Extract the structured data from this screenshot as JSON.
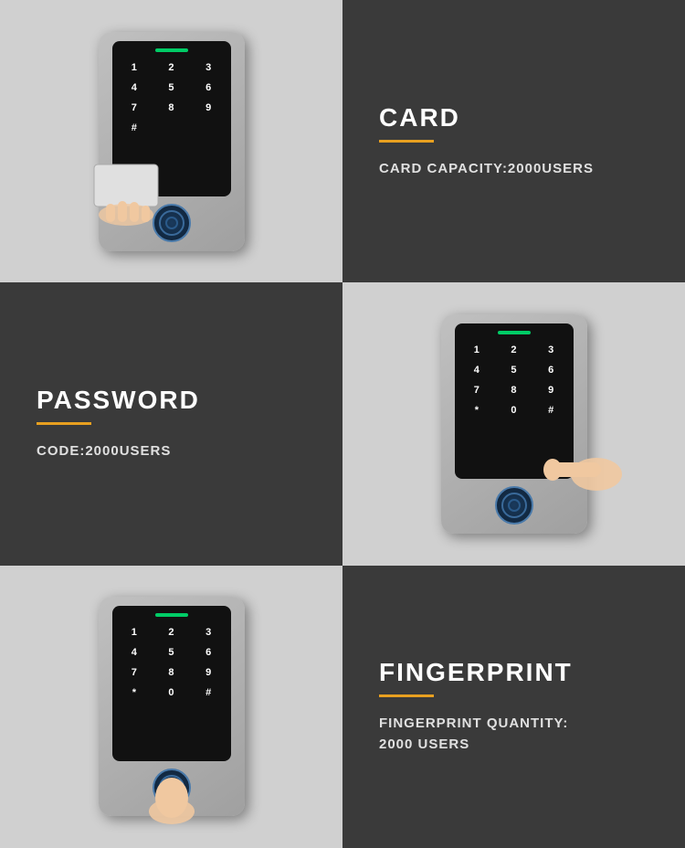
{
  "cells": {
    "card_title": "CARD",
    "card_desc": "CARD CAPACITY:2000USERS",
    "password_title": "PASSWORD",
    "password_desc": "CODE:2000USERS",
    "fingerprint_title": "FINGERPRINT",
    "fingerprint_desc": "FINGERPRINT QUANTITY:\n2000 USERS"
  },
  "keypad": {
    "keys": [
      "1",
      "2",
      "3",
      "4",
      "5",
      "6",
      "7",
      "8",
      "9",
      "*",
      "0",
      "#"
    ],
    "keys_alt1": [
      "1",
      "2",
      "3",
      "4",
      "5",
      "6",
      "7",
      "8",
      "9",
      "#"
    ],
    "keys_alt2": [
      "1",
      "2",
      "3",
      "4",
      "5",
      "6",
      "7",
      "8",
      "9",
      "*",
      "0",
      "#"
    ]
  },
  "colors": {
    "accent": "#e8a020",
    "dark_bg": "#3a3a3a",
    "light_bg": "#d0d0d0",
    "led_green": "#00cc66",
    "white": "#ffffff"
  }
}
